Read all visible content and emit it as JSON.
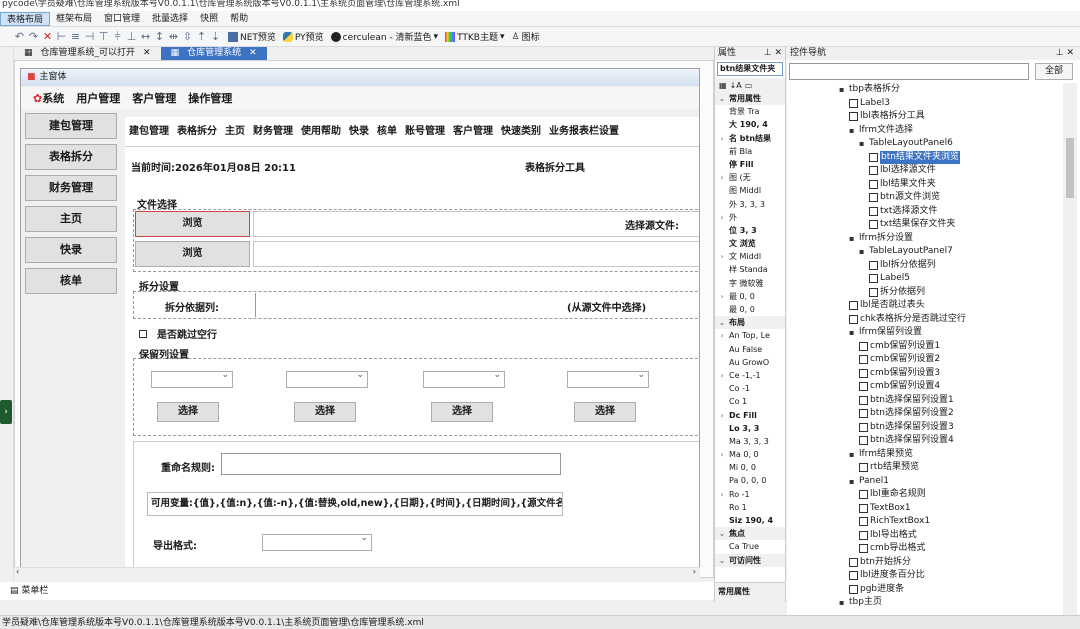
{
  "window": {
    "title": "pycode\\学员疑难\\仓库管理系统版本号V0.0.1.1\\仓库管理系统版本号V0.0.1.1\\主系统页面管理\\仓库管理系统.xml"
  },
  "menubar": [
    "表格布局",
    "框架布局",
    "窗口管理",
    "批量选择",
    "快照",
    "帮助"
  ],
  "toolbar": {
    "net_preview": "NET预览",
    "py_preview": "PY预览",
    "theme": "cerculean - 清新蓝色",
    "ttkb": "TTKB主题",
    "icon": "图标"
  },
  "doc_tabs": [
    {
      "label": "仓库管理系统_可以打开",
      "active": false
    },
    {
      "label": "仓库管理系统",
      "active": true
    }
  ],
  "form": {
    "title": "主窗体",
    "menu": [
      "系统",
      "用户管理",
      "客户管理",
      "操作管理"
    ],
    "nav_buttons": [
      "建包管理",
      "表格拆分",
      "财务管理",
      "主页",
      "快录",
      "核单"
    ],
    "tabs": [
      "建包管理",
      "表格拆分",
      "主页",
      "财务管理",
      "使用帮助",
      "快录",
      "核单",
      "账号管理",
      "客户管理",
      "快速类别",
      "业务报表栏设置"
    ],
    "current_time": "当前时间:2026年01月08日 20:11",
    "tool_title": "表格拆分工具",
    "file_select": "文件选择",
    "browse": "浏览",
    "select_source": "选择源文件:",
    "split_settings": "拆分设置",
    "split_by_col": "拆分依据列:",
    "from_source": "(从源文件中选择)",
    "skip_empty": "是否跳过空行",
    "keep_cols": "保留列设置",
    "select": "选择",
    "rename_rule": "重命名规则:",
    "vars": "可用变量:{值},{值:n},{值:-n},{值:替换,old,new},{日期},{时间},{日期时间},{源文件名}",
    "export_format": "导出格式:"
  },
  "bottom_label": "菜单栏",
  "status": "学员疑难\\仓库管理系统版本号V0.0.1.1\\仓库管理系统版本号V0.0.1.1\\主系统页面管理\\仓库管理系统.xml",
  "props": {
    "header": "属性",
    "combo": "btn结果文件夹",
    "rows": [
      {
        "t": "cat",
        "v": "常用属性"
      },
      {
        "t": "row",
        "v": "背景 Tra"
      },
      {
        "t": "row",
        "v": "大 190, 4",
        "hl": true
      },
      {
        "t": "row",
        "v": "名 btn结果",
        "hl": true
      },
      {
        "t": "row",
        "v": "前 Bla"
      },
      {
        "t": "row",
        "v": "停 Fill",
        "hl": true
      },
      {
        "t": "row",
        "v": "图 (无"
      },
      {
        "t": "row",
        "v": "图 Middl"
      },
      {
        "t": "row",
        "v": "外 3, 3, 3"
      },
      {
        "t": "row",
        "v": "外"
      },
      {
        "t": "row",
        "v": "位 3, 3",
        "hl": true
      },
      {
        "t": "row",
        "v": "文 浏览",
        "hl": true
      },
      {
        "t": "row",
        "v": "文 Middl"
      },
      {
        "t": "row",
        "v": "样 Standa"
      },
      {
        "t": "row",
        "v": "字 微软雅"
      },
      {
        "t": "row",
        "v": "最 0, 0"
      },
      {
        "t": "row",
        "v": "最 0, 0"
      },
      {
        "t": "cat",
        "v": "布局"
      },
      {
        "t": "row",
        "v": "An Top, Le"
      },
      {
        "t": "row",
        "v": "Au False"
      },
      {
        "t": "row",
        "v": "Au GrowO"
      },
      {
        "t": "row",
        "v": "Ce -1,-1"
      },
      {
        "t": "row",
        "v": "Co -1"
      },
      {
        "t": "row",
        "v": "Co 1"
      },
      {
        "t": "row",
        "v": "Dc Fill",
        "hl": true
      },
      {
        "t": "row",
        "v": "Lo 3, 3",
        "hl": true
      },
      {
        "t": "row",
        "v": "Ma 3, 3, 3"
      },
      {
        "t": "row",
        "v": "Ma 0, 0"
      },
      {
        "t": "row",
        "v": "Mi 0, 0"
      },
      {
        "t": "row",
        "v": "Pa 0, 0, 0"
      },
      {
        "t": "row",
        "v": "Ro -1"
      },
      {
        "t": "row",
        "v": "Ro 1"
      },
      {
        "t": "row",
        "v": "Siz 190, 4",
        "hl": true
      },
      {
        "t": "cat",
        "v": "焦点"
      },
      {
        "t": "row",
        "v": "Ca True"
      },
      {
        "t": "cat",
        "v": "可访问性"
      }
    ],
    "footer": "常用属性"
  },
  "nav": {
    "header": "控件导航",
    "all": "全部",
    "tree": [
      {
        "d": 0,
        "tog": "▪",
        "label": "tbp表格拆分"
      },
      {
        "d": 1,
        "chk": true,
        "label": "Label3"
      },
      {
        "d": 1,
        "chk": true,
        "label": "lbl表格拆分工具"
      },
      {
        "d": 1,
        "tog": "▪",
        "label": "lfrm文件选择"
      },
      {
        "d": 2,
        "tog": "▪",
        "label": "TableLayoutPanel6"
      },
      {
        "d": 3,
        "chk": true,
        "label": "btn结果文件夹浏览",
        "sel": true
      },
      {
        "d": 3,
        "chk": true,
        "label": "lbl选择源文件"
      },
      {
        "d": 3,
        "chk": true,
        "label": "lbl结果文件夹"
      },
      {
        "d": 3,
        "chk": true,
        "label": "btn源文件浏览"
      },
      {
        "d": 3,
        "chk": true,
        "label": "txt选择源文件"
      },
      {
        "d": 3,
        "chk": true,
        "label": "txt结果保存文件夹"
      },
      {
        "d": 1,
        "tog": "▪",
        "label": "lfrm拆分设置"
      },
      {
        "d": 2,
        "tog": "▪",
        "label": "TableLayoutPanel7"
      },
      {
        "d": 3,
        "chk": true,
        "label": "lbl拆分依据列"
      },
      {
        "d": 3,
        "chk": true,
        "label": "Label5"
      },
      {
        "d": 3,
        "chk": true,
        "label": "拆分依据列"
      },
      {
        "d": 1,
        "chk": true,
        "label": "lbl是否跳过表头"
      },
      {
        "d": 1,
        "chk": true,
        "label": "chk表格拆分是否跳过空行"
      },
      {
        "d": 1,
        "tog": "▪",
        "label": "lfrm保留列设置"
      },
      {
        "d": 2,
        "chk": true,
        "label": "cmb保留列设置1"
      },
      {
        "d": 2,
        "chk": true,
        "label": "cmb保留列设置2"
      },
      {
        "d": 2,
        "chk": true,
        "label": "cmb保留列设置3"
      },
      {
        "d": 2,
        "chk": true,
        "label": "cmb保留列设置4"
      },
      {
        "d": 2,
        "chk": true,
        "label": "btn选择保留列设置1"
      },
      {
        "d": 2,
        "chk": true,
        "label": "btn选择保留列设置2"
      },
      {
        "d": 2,
        "chk": true,
        "label": "btn选择保留列设置3"
      },
      {
        "d": 2,
        "chk": true,
        "label": "btn选择保留列设置4"
      },
      {
        "d": 1,
        "tog": "▪",
        "label": "lfrm结果预览"
      },
      {
        "d": 2,
        "chk": true,
        "label": "rtb结果预览"
      },
      {
        "d": 1,
        "tog": "▪",
        "label": "Panel1"
      },
      {
        "d": 2,
        "chk": true,
        "label": "lbl重命名规则"
      },
      {
        "d": 2,
        "chk": true,
        "label": "TextBox1"
      },
      {
        "d": 2,
        "chk": true,
        "label": "RichTextBox1"
      },
      {
        "d": 2,
        "chk": true,
        "label": "lbl导出格式"
      },
      {
        "d": 2,
        "chk": true,
        "label": "cmb导出格式"
      },
      {
        "d": 1,
        "chk": true,
        "label": "btn开始拆分"
      },
      {
        "d": 1,
        "chk": true,
        "label": "lbl进度条百分比"
      },
      {
        "d": 1,
        "chk": true,
        "label": "pgb进度条"
      },
      {
        "d": 0,
        "tog": "▪",
        "label": "tbp主页"
      }
    ]
  }
}
